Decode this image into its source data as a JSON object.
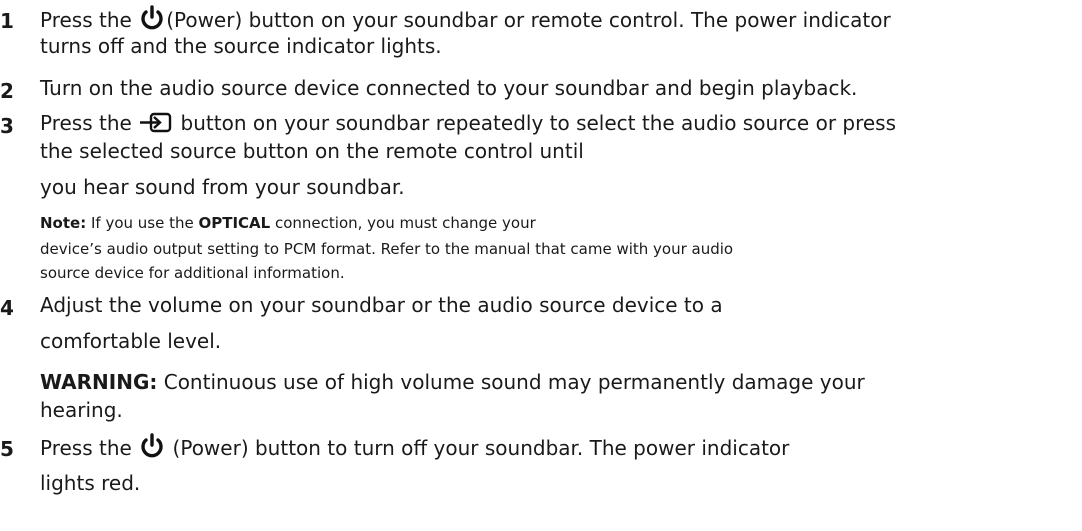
{
  "steps": [
    {
      "num": "1",
      "pre": "Press the ",
      "icon": "power-icon",
      "post_line1": "(Power) button on your soundbar or remote control. The power indicator",
      "line2": "turns off  and the source indicator lights."
    },
    {
      "num": "2",
      "line1": "Turn on the audio source device connected to your soundbar and begin playback."
    },
    {
      "num": "3",
      "pre": "Press the ",
      "icon": "source-input-icon",
      "post_line1": " button on your soundbar repeatedly to select the audio source or press",
      "line2": "the selected source button on the remote  control until",
      "line3": "you hear sound from your soundbar.",
      "note": {
        "label": "Note:",
        "text_a": " If you use the ",
        "bold": "OPTICAL",
        "text_b": " connection, you must change your",
        "line2": "device’s audio output setting to PCM format. Refer to the manual that came with your audio",
        "line3": "source device for additional information."
      }
    },
    {
      "num": "4",
      "line1": "Adjust the volume on your soundbar or the audio source device to a",
      "line2": "comfortable level.",
      "warning": {
        "label": "WARNING:",
        "text": " Continuous use of high volume sound may permanently damage your",
        "line2": "hearing."
      }
    },
    {
      "num": "5",
      "pre": "Press the ",
      "icon": "power-icon",
      "post_line1": " (Power) button to turn off your soundbar. The power indicator",
      "line2": "lights red."
    }
  ]
}
